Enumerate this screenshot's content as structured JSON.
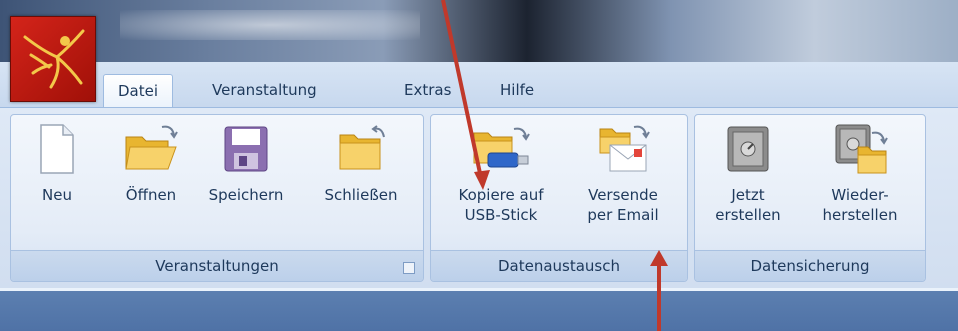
{
  "ribbon": {
    "tabs": [
      {
        "label": "Datei"
      },
      {
        "label": "Veranstaltung"
      },
      {
        "label": "Extras"
      },
      {
        "label": "Hilfe"
      }
    ],
    "groups": {
      "veranstaltungen": {
        "label": "Veranstaltungen",
        "buttons": [
          {
            "label": "Neu",
            "icon": "new-document-icon"
          },
          {
            "label": "Öffnen",
            "icon": "open-folder-icon"
          },
          {
            "label": "Speichern",
            "icon": "save-disk-icon"
          },
          {
            "label": "Schließen",
            "icon": "close-folder-icon"
          }
        ]
      },
      "datenaustausch": {
        "label": "Datenaustausch",
        "buttons": [
          {
            "label": "Kopiere auf\nUSB-Stick",
            "icon": "usb-stick-folder-icon"
          },
          {
            "label": "Versende\nper Email",
            "icon": "email-folder-icon"
          }
        ]
      },
      "datensicherung": {
        "label": "Datensicherung",
        "buttons": [
          {
            "label": "Jetzt\nerstellen",
            "icon": "safe-icon"
          },
          {
            "label": "Wieder-\nherstellen",
            "icon": "safe-restore-icon"
          }
        ]
      }
    }
  },
  "annotation_colors": {
    "arrow": "#c0392b"
  }
}
